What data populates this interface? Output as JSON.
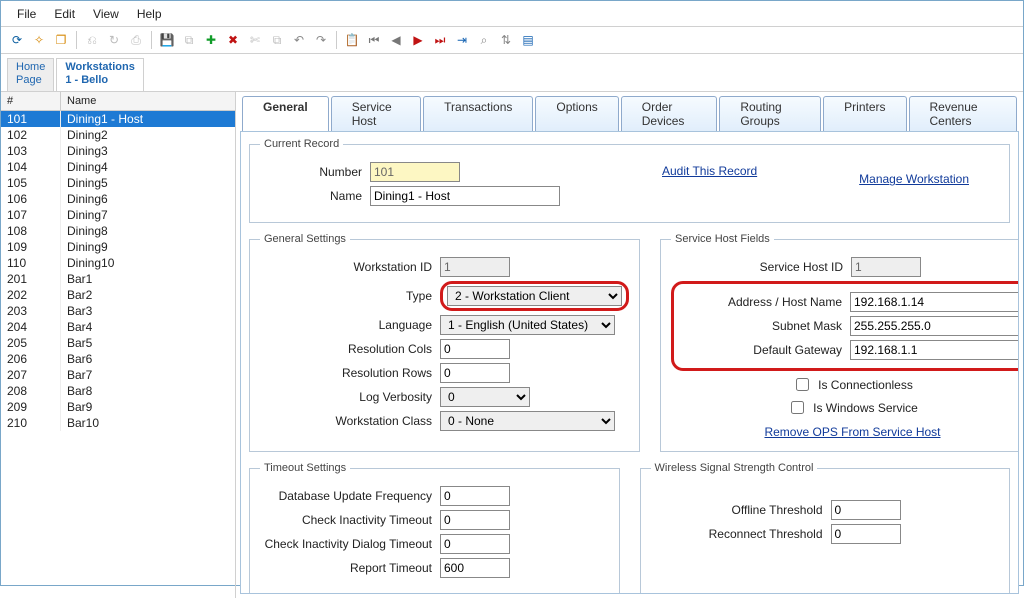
{
  "menu": {
    "file": "File",
    "edit": "Edit",
    "view": "View",
    "help": "Help"
  },
  "doctabs": {
    "home_l1": "Home",
    "home_l2": "Page",
    "ws_l1": "Workstations",
    "ws_l2": "1 - Bello"
  },
  "list": {
    "col_num": "#",
    "col_name": "Name",
    "rows": [
      {
        "n": "101",
        "name": "Dining1 - Host"
      },
      {
        "n": "102",
        "name": "Dining2"
      },
      {
        "n": "103",
        "name": "Dining3"
      },
      {
        "n": "104",
        "name": "Dining4"
      },
      {
        "n": "105",
        "name": "Dining5"
      },
      {
        "n": "106",
        "name": "Dining6"
      },
      {
        "n": "107",
        "name": "Dining7"
      },
      {
        "n": "108",
        "name": "Dining8"
      },
      {
        "n": "109",
        "name": "Dining9"
      },
      {
        "n": "110",
        "name": "Dining10"
      },
      {
        "n": "201",
        "name": "Bar1"
      },
      {
        "n": "202",
        "name": "Bar2"
      },
      {
        "n": "203",
        "name": "Bar3"
      },
      {
        "n": "204",
        "name": "Bar4"
      },
      {
        "n": "205",
        "name": "Bar5"
      },
      {
        "n": "206",
        "name": "Bar6"
      },
      {
        "n": "207",
        "name": "Bar7"
      },
      {
        "n": "208",
        "name": "Bar8"
      },
      {
        "n": "209",
        "name": "Bar9"
      },
      {
        "n": "210",
        "name": "Bar10"
      }
    ]
  },
  "tabs": {
    "general": "General",
    "service_host": "Service Host",
    "transactions": "Transactions",
    "options": "Options",
    "order_devices": "Order Devices",
    "routing_groups": "Routing Groups",
    "printers": "Printers",
    "revenue_centers": "Revenue Centers"
  },
  "record": {
    "legend": "Current Record",
    "number_label": "Number",
    "number": "101",
    "name_label": "Name",
    "name": "Dining1 - Host",
    "audit_link": "Audit This Record",
    "manage_link": "Manage Workstation"
  },
  "gs": {
    "legend": "General Settings",
    "ws_id_label": "Workstation ID",
    "ws_id": "1",
    "type_label": "Type",
    "type": "2 - Workstation Client",
    "lang_label": "Language",
    "lang": "1 - English (United States)",
    "res_cols_label": "Resolution Cols",
    "res_cols": "0",
    "res_rows_label": "Resolution Rows",
    "res_rows": "0",
    "log_verbosity_label": "Log Verbosity",
    "log_verbosity": "0",
    "ws_class_label": "Workstation Class",
    "ws_class": "0 - None"
  },
  "svc": {
    "legend": "Service Host Fields",
    "id_label": "Service Host ID",
    "id": "1",
    "addr_label": "Address / Host Name",
    "addr": "192.168.1.14",
    "mask_label": "Subnet Mask",
    "mask": "255.255.255.0",
    "gw_label": "Default Gateway",
    "gw": "192.168.1.1",
    "is_connectionless": "Is Connectionless",
    "is_windows_service": "Is Windows Service",
    "remove_link": "Remove OPS From Service Host"
  },
  "timeout": {
    "legend": "Timeout Settings",
    "db_upd_label": "Database Update Frequency",
    "db_upd": "0",
    "chk_inact_label": "Check Inactivity Timeout",
    "chk_inact": "0",
    "chk_dlg_label": "Check Inactivity Dialog Timeout",
    "chk_dlg": "0",
    "report_to_label": "Report Timeout",
    "report_to": "600"
  },
  "wifi": {
    "legend": "Wireless Signal Strength Control",
    "off_label": "Offline Threshold",
    "off": "0",
    "rec_label": "Reconnect Threshold",
    "rec": "0"
  }
}
